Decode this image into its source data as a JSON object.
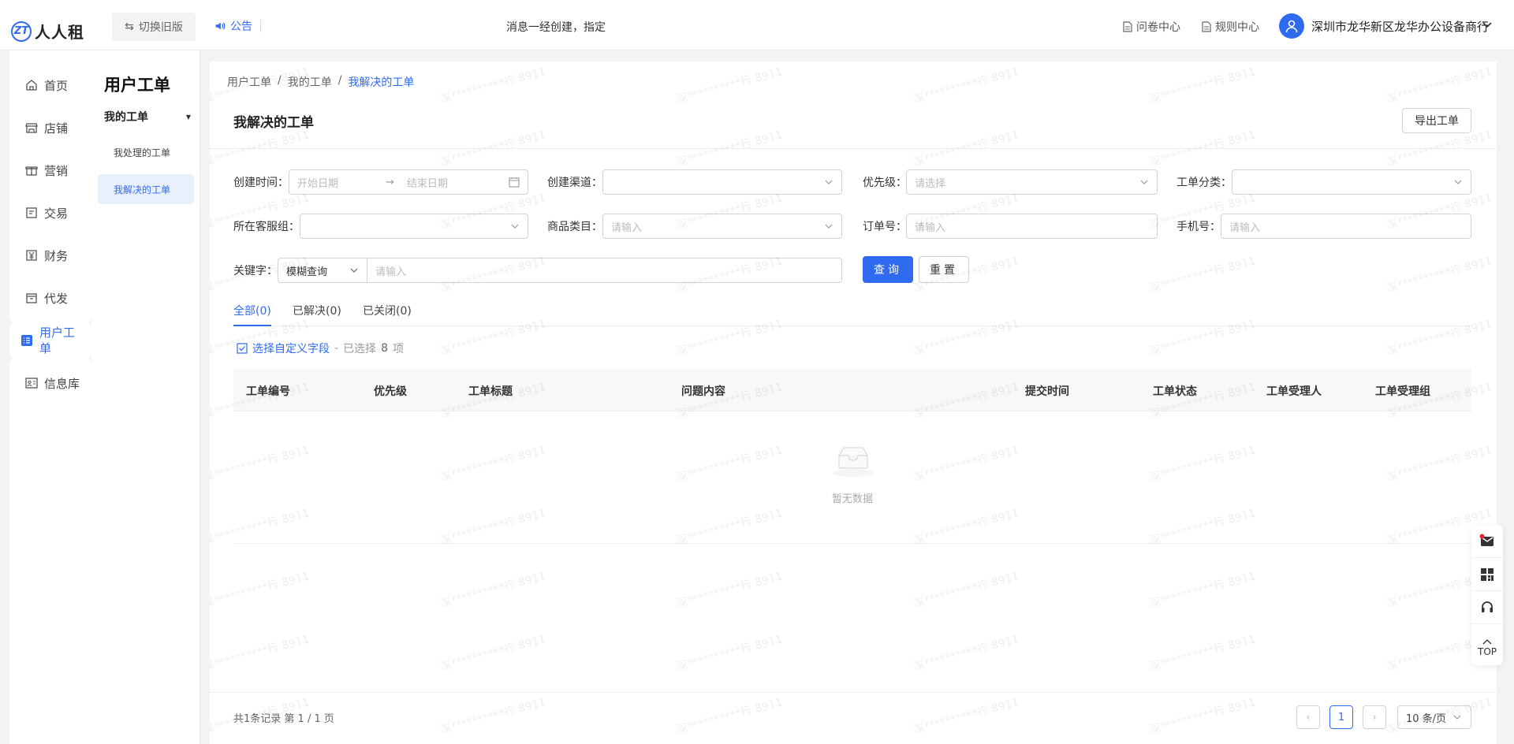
{
  "header": {
    "logo_text": "人人租",
    "logo_mark": "ZT",
    "switch_label": "切换旧版",
    "notice_label": "公告",
    "marquee": "消息一经创建，指定",
    "links": [
      "问卷中心",
      "规则中心"
    ],
    "shop_name": "深圳市龙华新区龙华办公设备商行"
  },
  "nav": {
    "items": [
      {
        "label": "首页",
        "icon": "home-icon"
      },
      {
        "label": "店铺",
        "icon": "store-icon"
      },
      {
        "label": "营销",
        "icon": "gift-icon"
      },
      {
        "label": "交易",
        "icon": "trade-icon"
      },
      {
        "label": "财务",
        "icon": "finance-icon"
      },
      {
        "label": "代发",
        "icon": "ship-icon"
      },
      {
        "label": "用户工单",
        "icon": "list-icon"
      },
      {
        "label": "信息库",
        "icon": "info-icon"
      }
    ]
  },
  "subnav": {
    "title": "用户工单",
    "group": "我的工单",
    "items": [
      "我处理的工单",
      "我解决的工单"
    ]
  },
  "breadcrumb": [
    "用户工单",
    "我的工单",
    "我解决的工单"
  ],
  "page": {
    "title": "我解决的工单",
    "export_label": "导出工单"
  },
  "filters": {
    "create_time_label": "创建时间",
    "start_placeholder": "开始日期",
    "end_placeholder": "结束日期",
    "channel_label": "创建渠道",
    "priority_label": "优先级",
    "priority_placeholder": "请选择",
    "category_label": "工单分类",
    "group_label": "所在客服组",
    "goods_label": "商品类目",
    "goods_placeholder": "请输入",
    "order_label": "订单号",
    "order_placeholder": "请输入",
    "phone_label": "手机号",
    "phone_placeholder": "请输入",
    "keyword_label": "关键字",
    "keyword_mode": "模糊查询",
    "keyword_placeholder": "请输入",
    "query_label": "查询",
    "reset_label": "重置"
  },
  "tabs": [
    "全部(0)",
    "已解决(0)",
    "已关闭(0)"
  ],
  "custom_field": {
    "link": "选择自定义字段",
    "sep": "-",
    "selected": "已选择",
    "count": "8",
    "unit": "项"
  },
  "table": {
    "columns": [
      "工单编号",
      "优先级",
      "工单标题",
      "问题内容",
      "提交时间",
      "工单状态",
      "工单受理人",
      "工单受理组"
    ],
    "empty_text": "暂无数据"
  },
  "pagination": {
    "total_text": "共1条记录 第 1 / 1 页",
    "current_page": "1",
    "page_size": "10 条/页"
  },
  "watermark": "深**********行 8911",
  "float": {
    "top_label": "TOP"
  },
  "colors": {
    "primary": "#2f6bf0",
    "badge": "#f5222d"
  }
}
